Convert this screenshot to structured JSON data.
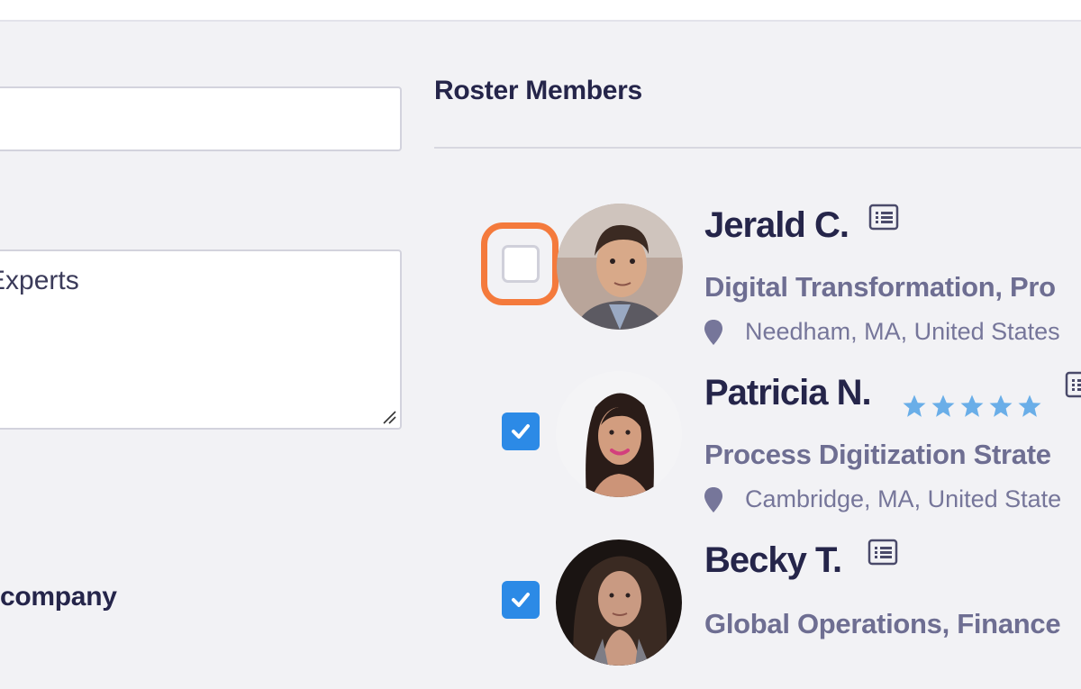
{
  "textarea": {
    "value": "Experts"
  },
  "company_label": "company",
  "roster": {
    "title": "Roster Members",
    "members": [
      {
        "name": "Jerald C.",
        "title": "Digital Transformation, Pro",
        "location": "Needham, MA, United States",
        "selected": false,
        "rating": null
      },
      {
        "name": "Patricia N.",
        "title": "Process Digitization Strate",
        "location": "Cambridge, MA, United State",
        "selected": true,
        "rating": 5
      },
      {
        "name": "Becky T.",
        "title": "Global Operations, Finance",
        "location": "",
        "selected": true,
        "rating": null
      }
    ]
  },
  "colors": {
    "accent_checkbox": "#2c8ae6",
    "highlight_ring": "#f47a3c",
    "star": "#6aaee8",
    "heading": "#25254a",
    "subtitle": "#6e6e92"
  },
  "icons": {
    "profile": "list-card-icon",
    "location": "map-pin-icon",
    "check": "checkmark-icon",
    "rating": "star-icon"
  }
}
